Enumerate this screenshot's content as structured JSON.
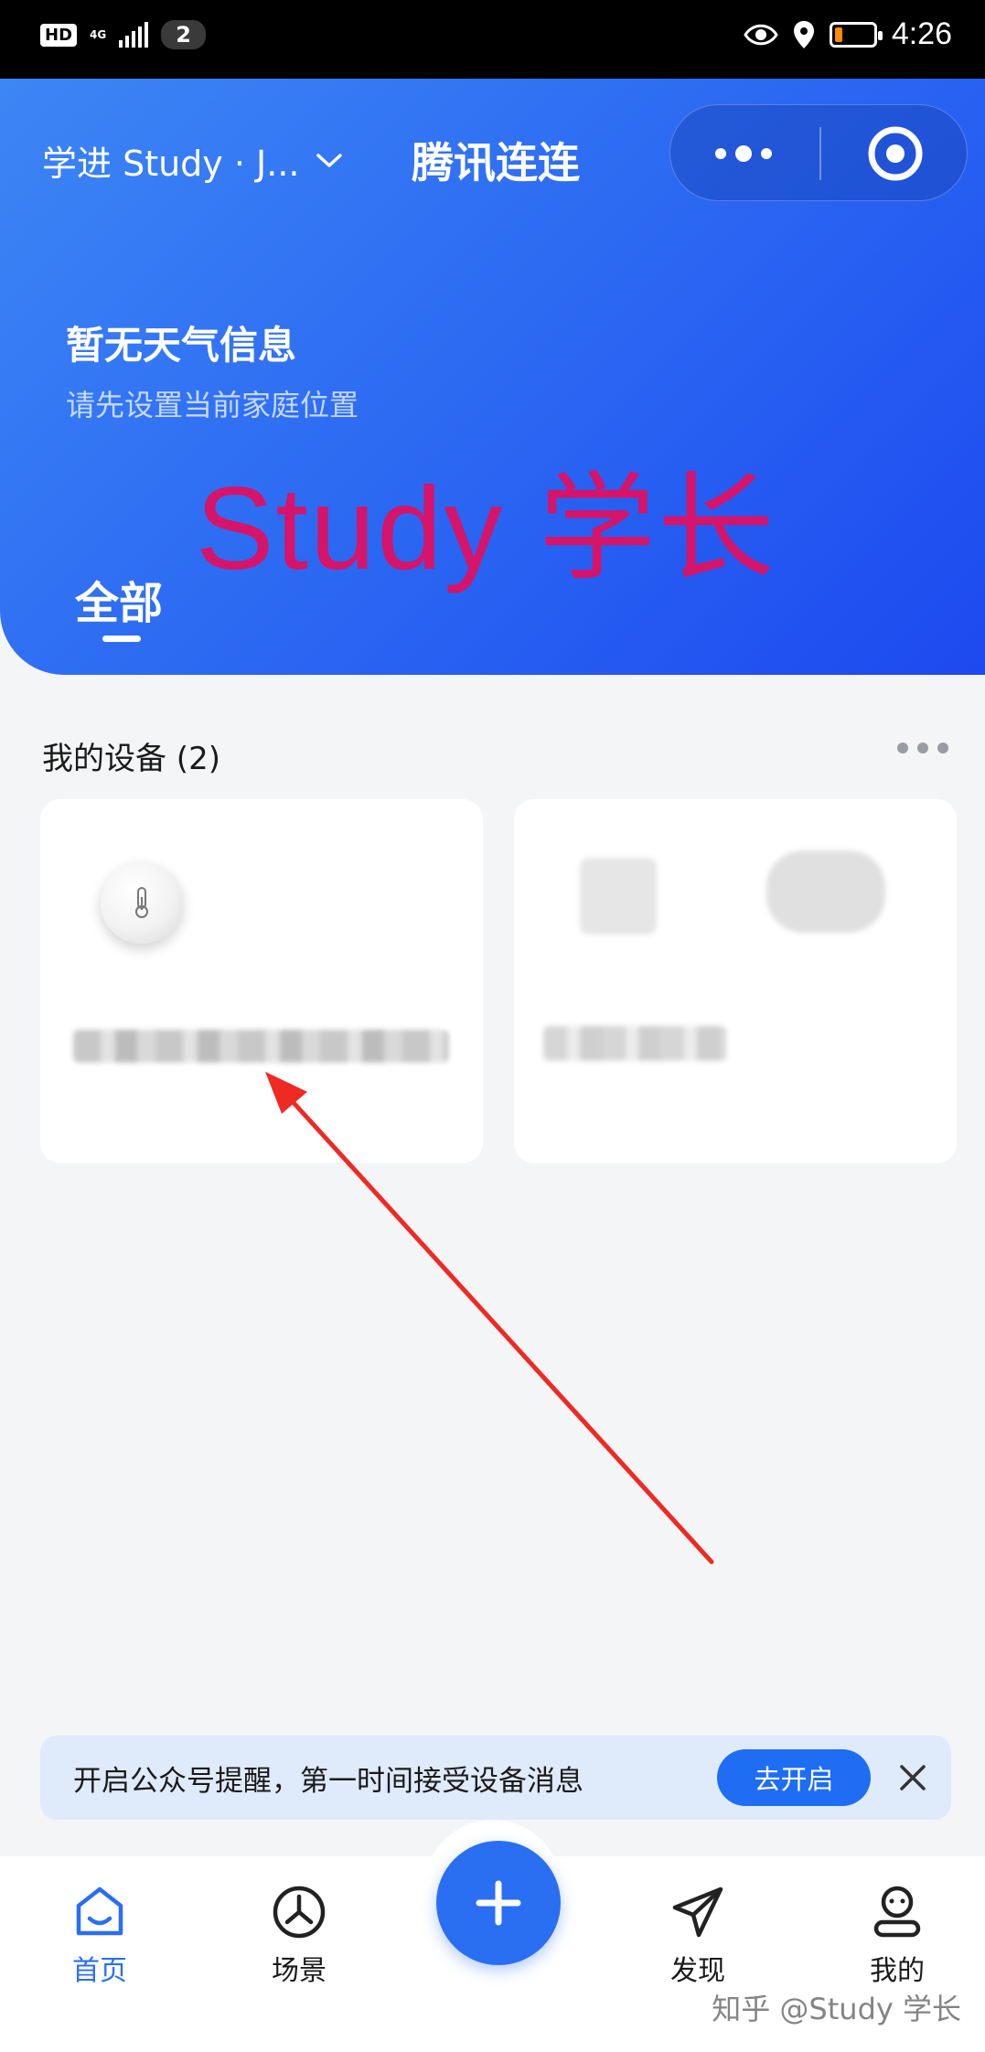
{
  "status_bar": {
    "hd": "HD",
    "network": "4G",
    "sim_count": "2",
    "time": "4:26"
  },
  "header": {
    "home_name": "学进 Study · J...",
    "app_title": "腾讯连连",
    "weather_title": "暂无天气信息",
    "weather_subtitle": "请先设置当前家庭位置",
    "watermark": "Study 学长",
    "tab_all": "全部"
  },
  "devices": {
    "section_title": "我的设备 (2)",
    "items": [
      {
        "icon": "thermometer-icon",
        "name_blurred": true
      },
      {
        "icon": "device-image",
        "name_blurred": true
      }
    ]
  },
  "banner": {
    "text": "开启公众号提醒，第一时间接受设备消息",
    "button": "去开启"
  },
  "bottom_nav": {
    "items": [
      {
        "label": "首页",
        "icon": "home-icon",
        "active": true
      },
      {
        "label": "场景",
        "icon": "scene-clock-icon",
        "active": false
      },
      {
        "label": "发现",
        "icon": "discover-plane-icon",
        "active": false
      },
      {
        "label": "我的",
        "icon": "profile-icon",
        "active": false
      }
    ]
  },
  "colors": {
    "primary": "#2a6ef2",
    "header_gradient_start": "#3d86f5",
    "header_gradient_end": "#1d49f0",
    "watermark": "#d5146a",
    "arrow": "#ee2a24"
  },
  "footer_watermark": "知乎 @Study 学长"
}
